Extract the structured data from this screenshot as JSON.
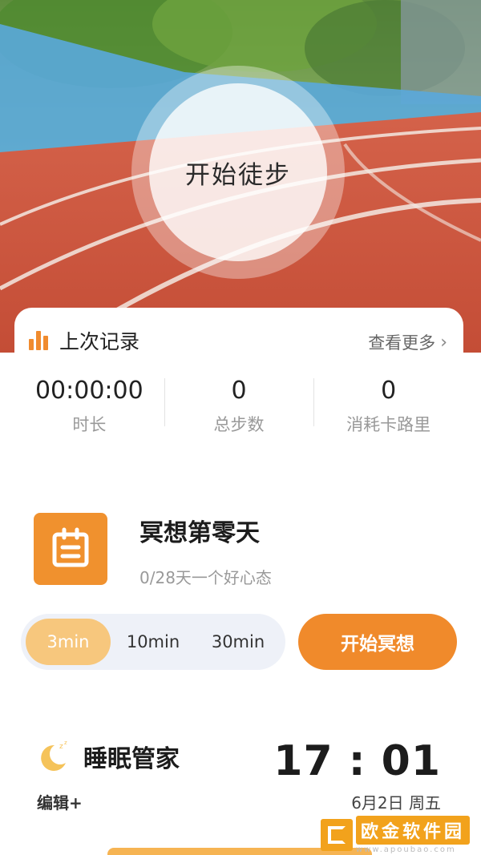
{
  "hero": {
    "start_button_label": "开始徒步"
  },
  "record": {
    "title": "上次记录",
    "more_label": "查看更多",
    "stats": [
      {
        "value": "00:00:00",
        "label": "时长"
      },
      {
        "value": "0",
        "label": "总步数"
      },
      {
        "value": "0",
        "label": "消耗卡路里"
      }
    ]
  },
  "meditation": {
    "title": "冥想第零天",
    "subtitle": "0/28天一个好心态",
    "durations": [
      "3min",
      "10min",
      "30min"
    ],
    "selected_duration": "3min",
    "start_label": "开始冥想"
  },
  "sleep": {
    "title": "睡眠管家",
    "edit_label": "编辑+",
    "time": "17 : 01",
    "date": "6月2日 周五"
  },
  "watermark": {
    "text": "欧金软件园",
    "sub": "www.apoubao.com"
  },
  "colors": {
    "accent": "#f08a2b",
    "selected_pill": "#f7c77d",
    "track": "#c8533a"
  }
}
